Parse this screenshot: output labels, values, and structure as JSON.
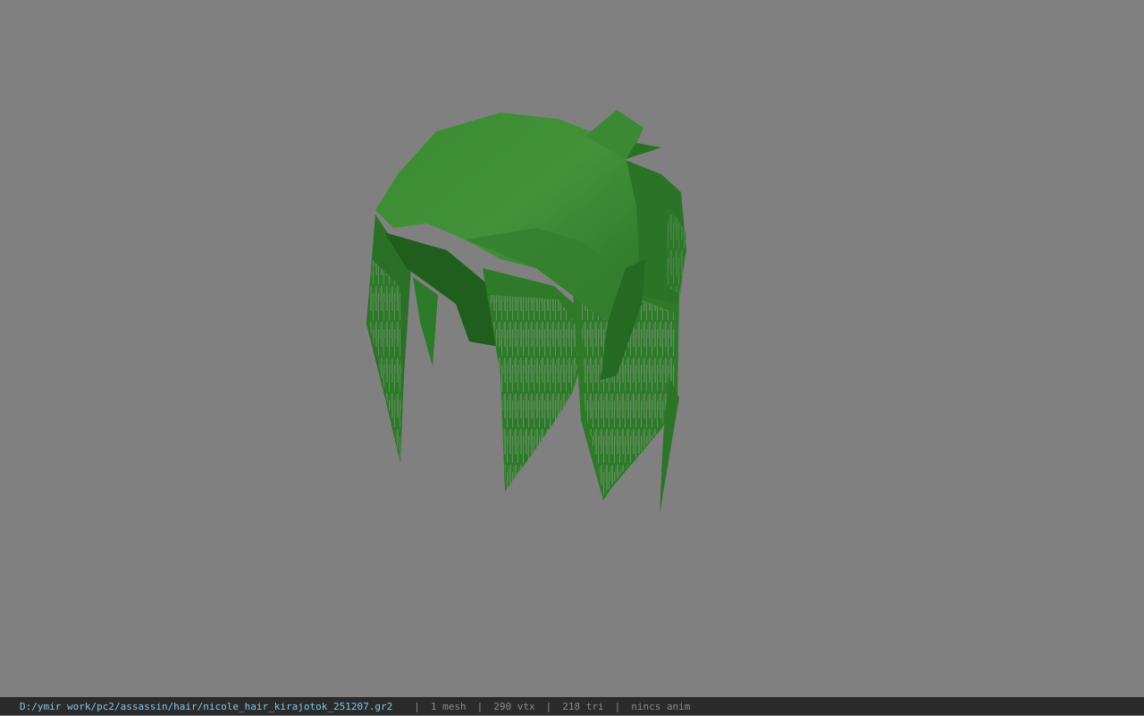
{
  "viewport": {
    "background_color": "#808080",
    "model_icon": "hair-mesh",
    "model_colors": {
      "light": "#3f8f36",
      "mid": "#2f7a29",
      "dark": "#1f5e1d",
      "strand": "#a6a6a6"
    }
  },
  "statusbar": {
    "file_path": "D:/ymir work/pc2/assassin/hair/nicole_hair_kirajotok_251207.gr2",
    "separator": "|",
    "mesh_count": "1 mesh",
    "vertex_count": "290 vtx",
    "triangle_count": "218 tri",
    "anim_status": "nincs anim",
    "path_color": "#7fc6e6",
    "text_color": "#8a8a8a"
  }
}
